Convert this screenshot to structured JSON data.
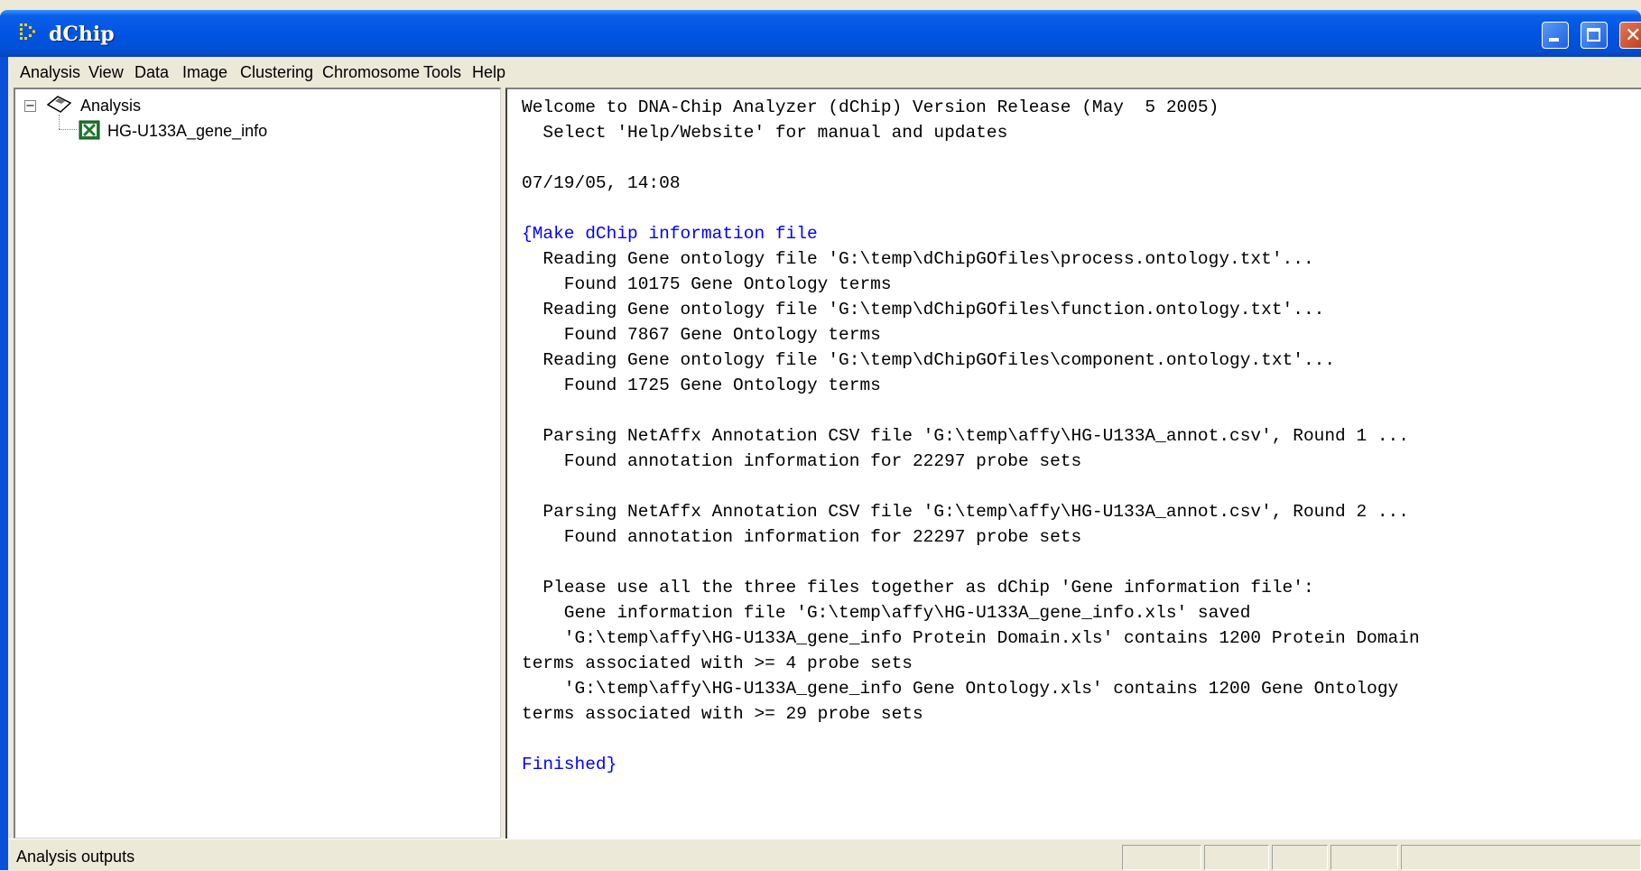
{
  "window": {
    "title": "dChip",
    "icon": "dchip-app-icon",
    "controls": [
      "minimize",
      "maximize",
      "close"
    ]
  },
  "menu": [
    {
      "label": "Analysis"
    },
    {
      "label": "View"
    },
    {
      "label": "Data"
    },
    {
      "label": "Image"
    },
    {
      "label": "Clustering"
    },
    {
      "label": "Chromosome"
    },
    {
      "label": "Tools"
    },
    {
      "label": "Help"
    }
  ],
  "tree": {
    "expander": "−",
    "root": {
      "label": "Analysis",
      "icon": "folder-icon"
    },
    "children": [
      {
        "label": "HG-U133A_gene_info",
        "icon": "excel-file-icon"
      }
    ]
  },
  "output": {
    "lines": [
      {
        "text": "Welcome to DNA-Chip Analyzer (dChip) Version Release (May  5 2005)",
        "color": "black"
      },
      {
        "text": "  Select 'Help/Website' for manual and updates",
        "color": "black"
      },
      {
        "text": "",
        "color": "black"
      },
      {
        "text": "07/19/05, 14:08",
        "color": "black"
      },
      {
        "text": "",
        "color": "black"
      },
      {
        "text": "{Make dChip information file",
        "color": "blue"
      },
      {
        "text": "  Reading Gene ontology file 'G:\\temp\\dChipGOfiles\\process.ontology.txt'...",
        "color": "black"
      },
      {
        "text": "    Found 10175 Gene Ontology terms",
        "color": "black"
      },
      {
        "text": "  Reading Gene ontology file 'G:\\temp\\dChipGOfiles\\function.ontology.txt'...",
        "color": "black"
      },
      {
        "text": "    Found 7867 Gene Ontology terms",
        "color": "black"
      },
      {
        "text": "  Reading Gene ontology file 'G:\\temp\\dChipGOfiles\\component.ontology.txt'...",
        "color": "black"
      },
      {
        "text": "    Found 1725 Gene Ontology terms",
        "color": "black"
      },
      {
        "text": "",
        "color": "black"
      },
      {
        "text": "  Parsing NetAffx Annotation CSV file 'G:\\temp\\affy\\HG-U133A_annot.csv', Round 1 ...",
        "color": "black"
      },
      {
        "text": "    Found annotation information for 22297 probe sets",
        "color": "black"
      },
      {
        "text": "",
        "color": "black"
      },
      {
        "text": "  Parsing NetAffx Annotation CSV file 'G:\\temp\\affy\\HG-U133A_annot.csv', Round 2 ...",
        "color": "black"
      },
      {
        "text": "    Found annotation information for 22297 probe sets",
        "color": "black"
      },
      {
        "text": "",
        "color": "black"
      },
      {
        "text": "  Please use all the three files together as dChip 'Gene information file':",
        "color": "black"
      },
      {
        "text": "    Gene information file 'G:\\temp\\affy\\HG-U133A_gene_info.xls' saved",
        "color": "black"
      },
      {
        "text": "    'G:\\temp\\affy\\HG-U133A_gene_info Protein Domain.xls' contains 1200 Protein Domain",
        "color": "black"
      },
      {
        "text": "terms associated with >= 4 probe sets",
        "color": "black"
      },
      {
        "text": "    'G:\\temp\\affy\\HG-U133A_gene_info Gene Ontology.xls' contains 1200 Gene Ontology",
        "color": "black"
      },
      {
        "text": "terms associated with >= 29 probe sets",
        "color": "black"
      },
      {
        "text": "",
        "color": "black"
      },
      {
        "text": "Finished}",
        "color": "blue"
      }
    ]
  },
  "statusbar": {
    "text": "Analysis outputs"
  },
  "colors": {
    "titlebar": "#0054e3",
    "chrome": "#ece9d8",
    "log_highlight": "#0000ff"
  }
}
